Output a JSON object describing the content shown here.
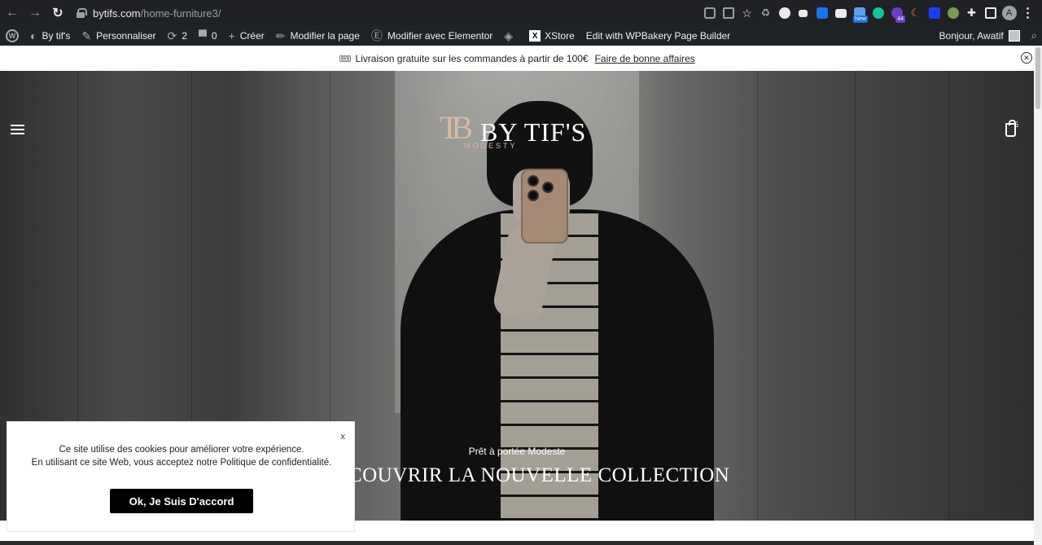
{
  "browser": {
    "url_host": "bytifs.com",
    "url_path": "/home-furniture3/",
    "avatar_letter": "A",
    "extension_badges": {
      "new": "New",
      "count": "44"
    }
  },
  "wp_admin_bar": {
    "site_name": "By tif's",
    "customize": "Personnaliser",
    "updates_count": "2",
    "comments_count": "0",
    "new_label": "Créer",
    "edit_page": "Modifier la page",
    "edit_elementor": "Modifier avec Elementor",
    "xstore": "XStore",
    "wpbakery": "Edit with WPBakery Page Builder",
    "greeting": "Bonjour, Awatif"
  },
  "promo": {
    "text": "Livraison gratuite sur les commandes à partir de 100€",
    "link": "Faire de bonne affaires"
  },
  "header": {
    "logo_monogram": "TB",
    "logo_text": "BY TIF'S",
    "logo_sub": "MODESTY",
    "cart_count": "5"
  },
  "hero": {
    "subtitle": "Prêt à portée Modeste",
    "title": "DECOUVRIR LA NOUVELLE COLLECTION"
  },
  "cookie": {
    "line1": "Ce site utilise des cookies pour améliorer votre expérience.",
    "line2": "En utilisant ce site Web, vous acceptez notre Politique de confidentialité.",
    "close": "x",
    "accept": "Ok, Je Suis D'accord"
  },
  "colors": {
    "accent_logo": "#d8b9a3",
    "wp_bar": "#1d2327",
    "browser_bar": "#202124",
    "button": "#000000"
  },
  "icons": [
    "back-arrow-icon",
    "forward-arrow-icon",
    "reload-icon",
    "lock-icon",
    "translate-icon",
    "share-icon",
    "star-icon",
    "extensions-icon",
    "wordpress-icon",
    "customize-brush-icon",
    "updates-icon",
    "comments-icon",
    "plus-icon",
    "pencil-icon",
    "elementor-icon",
    "diamond-icon",
    "xstore-icon",
    "ticket-icon",
    "close-circle-icon",
    "hamburger-menu-icon",
    "shopping-bag-icon",
    "search-icon"
  ]
}
